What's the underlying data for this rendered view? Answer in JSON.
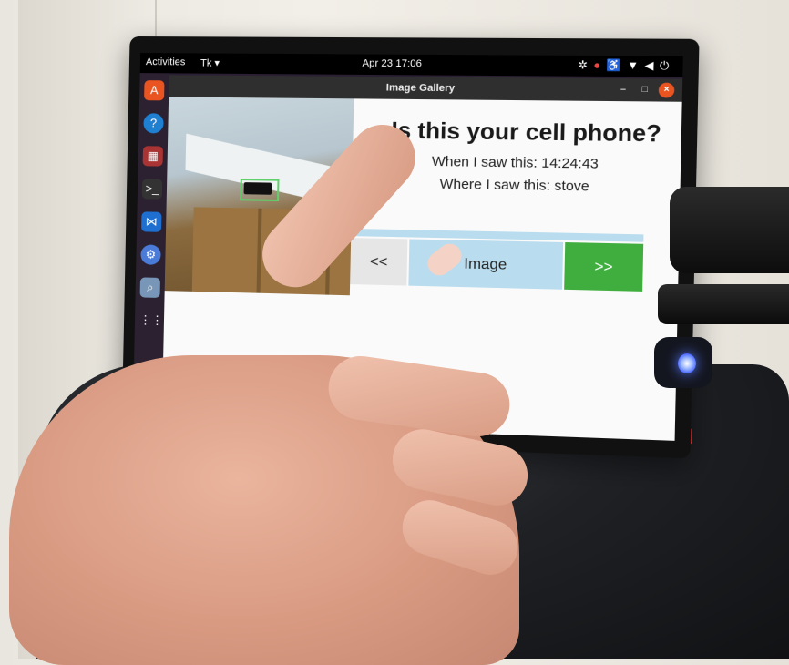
{
  "desktop": {
    "activities_label": "Activities",
    "app_menu_label": "Tk ▾",
    "clock": "Apr 23  17:06",
    "tray_icons": [
      "network-icon",
      "notification-icon",
      "accessibility-icon",
      "wifi-icon",
      "volume-icon",
      "power-icon"
    ]
  },
  "dock": {
    "icons": [
      "software-center-icon",
      "help-icon",
      "presentation-icon",
      "terminal-icon",
      "vscode-icon",
      "settings-icon",
      "search-icon",
      "show-apps-icon"
    ]
  },
  "window": {
    "title": "Image Gallery",
    "controls": [
      "minimize",
      "maximize",
      "close"
    ]
  },
  "gallery": {
    "question": "Is this your cell phone?",
    "when_text": "When I saw this: 14:24:43",
    "where_text": "Where I saw this: stove",
    "prev_label": "<<",
    "image_label": "Image",
    "next_label": ">>"
  },
  "colors": {
    "next_button": "#3fae3f",
    "image_button": "#b9dcee",
    "prev_button": "#e6e6e6",
    "detection_box": "#5fd16a",
    "status_led": "#3352ff"
  }
}
